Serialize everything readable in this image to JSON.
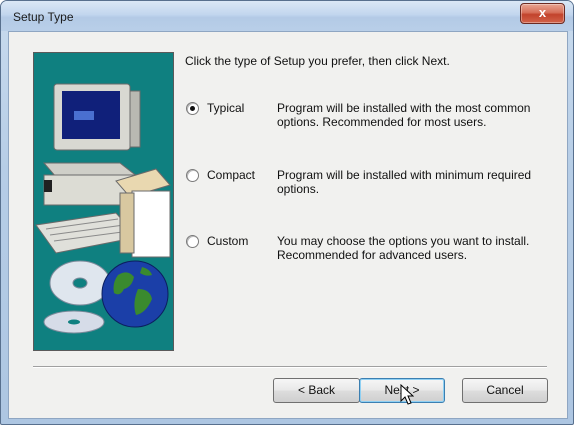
{
  "window": {
    "title": "Setup Type",
    "close_glyph": "x"
  },
  "prompt": "Click the type of Setup you prefer, then click Next.",
  "options": [
    {
      "label": "Typical",
      "description": "Program will be installed with the most common options.  Recommended for most users.",
      "selected": true
    },
    {
      "label": "Compact",
      "description": "Program will be installed with minimum required options.",
      "selected": false
    },
    {
      "label": "Custom",
      "description": "You may choose the options you want to install. Recommended for advanced users.",
      "selected": false
    }
  ],
  "buttons": {
    "back": "< Back",
    "next": "Next >",
    "cancel": "Cancel"
  },
  "colors": {
    "art_background": "#0f8080",
    "close_button": "#c2432c",
    "default_button_border": "#3c7fb1"
  },
  "icons": {
    "artwork": "computer-with-cds-and-globe",
    "pointer": "mouse-cursor-arrow"
  }
}
